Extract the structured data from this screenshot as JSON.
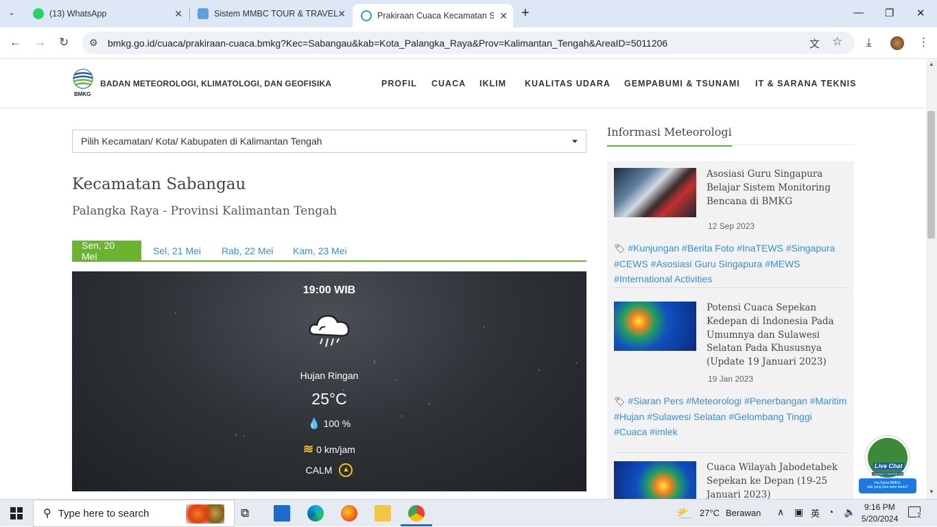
{
  "browser": {
    "tabs": [
      {
        "label": "(13) WhatsApp",
        "active": false
      },
      {
        "label": "Sistem MMBC TOUR & TRAVEL",
        "active": false
      },
      {
        "label": "Prakiraan Cuaca Kecamatan Sab",
        "active": true
      }
    ],
    "new_tab": "+",
    "url": "bmkg.go.id/cuaca/prakiraan-cuaca.bmkg?Kec=Sabangau&kab=Kota_Palangka_Raya&Prov=Kalimantan_Tengah&AreaID=5011206"
  },
  "site": {
    "logo_text": "BMKG",
    "brand": "BADAN METEOROLOGI, KLIMATOLOGI, DAN GEOFISIKA",
    "nav": [
      "PROFIL",
      "CUACA",
      "IKLIM",
      "KUALITAS UDARA",
      "GEMPABUMI & TSUNAMI",
      "IT & SARANA TEKNIS"
    ]
  },
  "main": {
    "select_placeholder": "Pilih Kecamatan/ Kota/ Kabupaten di Kalimantan Tengah",
    "title": "Kecamatan Sabangau",
    "subtitle": "Palangka Raya - Provinsi Kalimantan Tengah",
    "day_tabs": [
      "Sen, 20 Mei",
      "Sel, 21 Mei",
      "Rab, 22 Mei",
      "Kam, 23 Mei"
    ],
    "active_day": 0,
    "forecast": {
      "time": "19:00 WIB",
      "icon": "rain-cloud-icon",
      "description": "Hujan Ringan",
      "temperature": "25°C",
      "humidity": "100 %",
      "wind_speed": "0 km/jam",
      "wind_direction": "CALM"
    }
  },
  "sidebar": {
    "title": "Informasi Meteorologi",
    "news": [
      {
        "title": "Asosiasi Guru Singapura Belajar Sistem Monitoring Bencana di BMKG",
        "date": "12 Sep 2023",
        "tags": "#Kunjungan #Berita Foto #InaTEWS #Singapura #CEWS #Asosiasi Guru Singapura #MEWS #International Activities"
      },
      {
        "title": "Potensi Cuaca Sepekan Kedepan di Indonesia Pada Umumnya dan Sulawesi Selatan Pada Khususnya (Update 19 Januari 2023)",
        "date": "19 Jan 2023",
        "tags": "#Siaran Pers #Meteorologi #Penerbangan #Maritim #Hujan #Sulawesi Selatan #Gelombang Tinggi #Cuaca #imlek"
      },
      {
        "title": "Cuaca Wilayah Jabodetabek Sepekan ke Depan (19-25 Januari 2023)",
        "date": "",
        "tags": ""
      }
    ],
    "live_chat": {
      "label": "Live Chat",
      "sub": "CONTACT CENTER 196",
      "greeting1": "Hai Sobat BMKG,",
      "greeting2": "ada yang bisa kami bantu?"
    }
  },
  "taskbar": {
    "search_placeholder": "Type here to search",
    "weather_temp": "27°C",
    "weather_desc": "Berawan",
    "time": "9:16 PM",
    "date": "5/20/2024",
    "notification_count": "2"
  },
  "colors": {
    "accent_green": "#6ab42f",
    "link_blue": "#3a8fd8"
  }
}
